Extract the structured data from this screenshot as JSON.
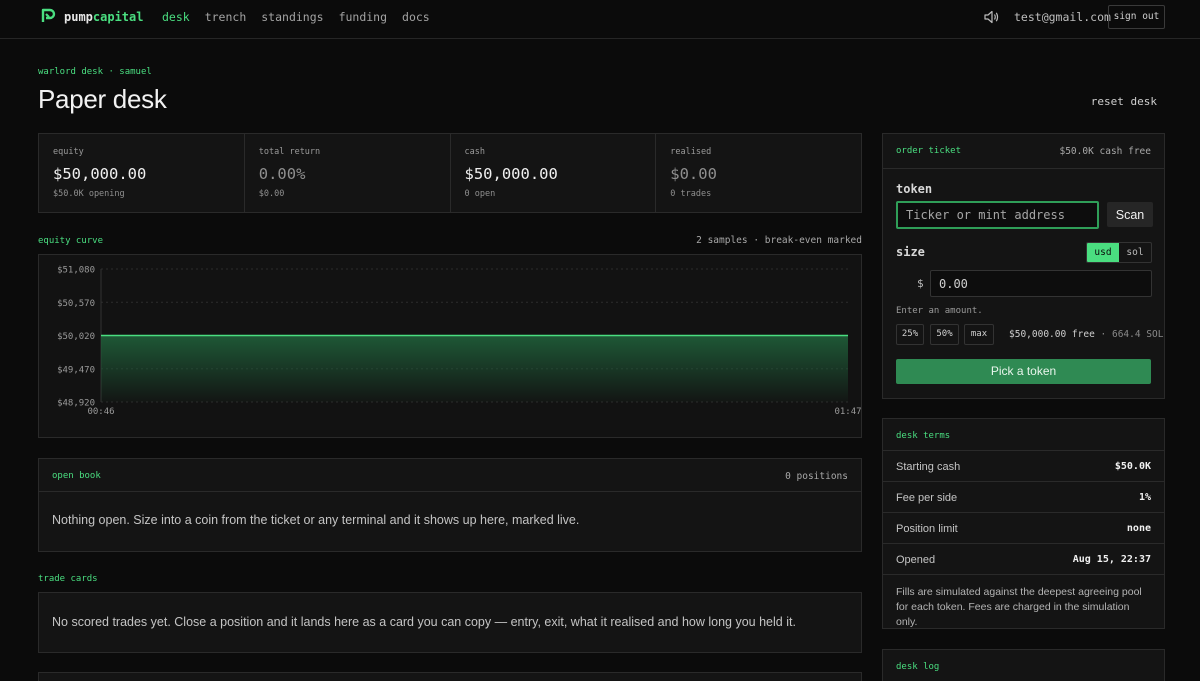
{
  "brand": {
    "part1": "pump",
    "part2": "capital"
  },
  "nav": {
    "items": [
      "desk",
      "trench",
      "standings",
      "funding",
      "docs"
    ],
    "active": "desk"
  },
  "user": {
    "email": "test@gmail.com",
    "sign_out": "sign out"
  },
  "header": {
    "breadcrumb": "warlord desk · samuel",
    "title": "Paper desk",
    "reset": "reset desk"
  },
  "stats": [
    {
      "label": "equity",
      "value": "$50,000.00",
      "sub": "$50.0K opening"
    },
    {
      "label": "total return",
      "value": "0.00%",
      "sub": "$0.00"
    },
    {
      "label": "cash",
      "value": "$50,000.00",
      "sub": "0 open"
    },
    {
      "label": "realised",
      "value": "$0.00",
      "sub": "0 trades"
    }
  ],
  "equity_curve": {
    "label": "equity curve",
    "note": "2 samples · break-even marked"
  },
  "chart_data": {
    "type": "area",
    "x": [
      "00:46",
      "01:47"
    ],
    "values": [
      50000,
      50000
    ],
    "y_ticks": [
      "$51,080",
      "$50,570",
      "$50,020",
      "$49,470",
      "$48,920"
    ],
    "ylim": [
      48920,
      51080
    ],
    "break_even": 50000,
    "grid": true,
    "colors": {
      "line": "#4ade80",
      "fill": "#1f5c38"
    }
  },
  "open_book": {
    "label": "open book",
    "count": "0 positions",
    "empty": "Nothing open. Size into a coin from the ticket or any terminal and it shows up here, marked live."
  },
  "trade_cards": {
    "label": "trade cards",
    "empty": "No scored trades yet. Close a position and it lands here as a card you can copy — entry, exit, what it realised and how long you held it."
  },
  "ticket": {
    "title": "order ticket",
    "cash_free": "$50.0K cash free",
    "token_label": "token",
    "token_placeholder": "Ticker or mint address",
    "scan": "Scan",
    "size_label": "size",
    "units": [
      "usd",
      "sol"
    ],
    "active_unit": "usd",
    "currency_symbol": "$",
    "amount_placeholder": "0.00",
    "hint": "Enter an amount.",
    "presets": [
      "25%",
      "50%",
      "max"
    ],
    "free_usd": "$50,000.00 free",
    "free_sol": "· 664.4 SOL",
    "submit": "Pick a token"
  },
  "terms": {
    "title": "desk terms",
    "rows": [
      {
        "k": "Starting cash",
        "v": "$50.0K"
      },
      {
        "k": "Fee per side",
        "v": "1%"
      },
      {
        "k": "Position limit",
        "v": "none"
      },
      {
        "k": "Opened",
        "v": "Aug 15, 22:37"
      }
    ],
    "note": "Fills are simulated against the deepest agreeing pool for each token. Fees are charged in the simulation only."
  },
  "log": {
    "title": "desk log"
  },
  "colors": {
    "accent": "#4ade80",
    "bg": "#0b0b0b",
    "panel": "#141414",
    "button": "#2f8a53"
  }
}
